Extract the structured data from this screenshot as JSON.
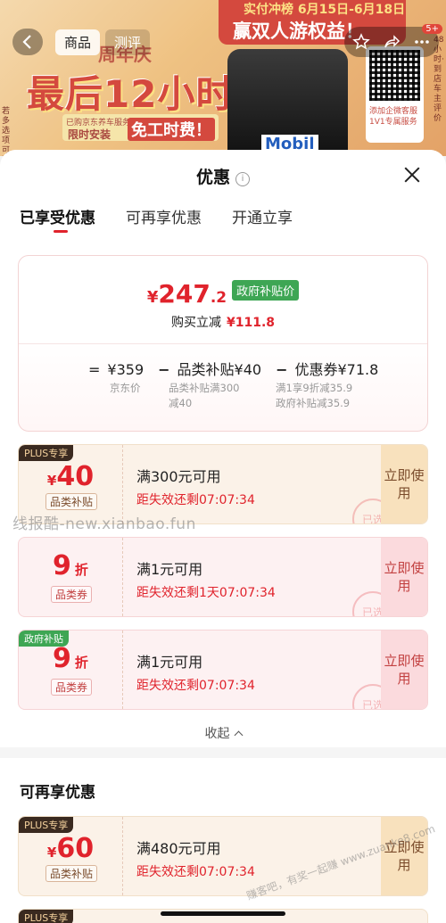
{
  "banner": {
    "tabs": [
      "商品",
      "测评"
    ],
    "badge": "5+",
    "ribbon_top": "实付冲榜  6月15日-6月18日",
    "ribbon_main": "赢双人游权益！",
    "promo_sub": "周年庆",
    "promo_big": "最后12小时",
    "promo_small": "已购京东养车服务可用",
    "promo_install": "限时安装",
    "promo_free": "免工时费！",
    "product_brand": "Mobil",
    "qr_text": "添加企微客服 1V1专属服务",
    "side_text": "48小时·到店车主评价",
    "left_text": "若多选项可选"
  },
  "sheet": {
    "title": "优惠",
    "info_icon": "i",
    "tabs": [
      "已享受优惠",
      "可再享优惠",
      "开通立享"
    ],
    "summary": {
      "yen": "¥",
      "price_int": "247",
      "price_dec": ".2",
      "gov_tag": "政府补贴价",
      "reduce_label": "购买立减",
      "reduce_value": "¥111.8",
      "formula": {
        "eq": "=",
        "base": "¥359",
        "minus": "−",
        "cat_sub": "品类补贴¥40",
        "coupon": "优惠券¥71.8",
        "base_note": "京东价",
        "cat_note_1": "品类补贴满300",
        "cat_note_2": "减40",
        "coupon_note_1": "满1享9折减35.9",
        "coupon_note_2": "政府补贴减35.9"
      }
    },
    "coupons": [
      {
        "corner": "PLUS专享",
        "yen": "¥",
        "amount": "40",
        "kind": "品类补贴",
        "cond": "满300元可用",
        "timer": "距失效还剩07:07:34",
        "use": "立即使用",
        "stamp": "已选"
      },
      {
        "corner": "",
        "amount": "9",
        "unit": "折",
        "kind": "品类券",
        "cond": "满1元可用",
        "timer": "距失效还剩1天07:07:34",
        "use": "立即使用",
        "stamp": "已选"
      },
      {
        "corner": "政府补贴",
        "amount": "9",
        "unit": "折",
        "kind": "品类券",
        "cond": "满1元可用",
        "timer": "距失效还剩07:07:34",
        "use": "立即使用",
        "stamp": "已选"
      }
    ],
    "collapse": "收起",
    "watermark": "线报酷-new.xianbao.fun",
    "section2": {
      "heading": "可再享优惠",
      "coupon": {
        "corner": "PLUS专享",
        "yen": "¥",
        "amount": "60",
        "kind": "品类补贴",
        "cond": "满480元可用",
        "timer": "距失效还剩07:07:34",
        "use": "立即使用"
      },
      "peek_corner": "PLUS专享"
    },
    "corner_mark": "赚客吧，有奖一起赚 www.zuanke8.com"
  }
}
